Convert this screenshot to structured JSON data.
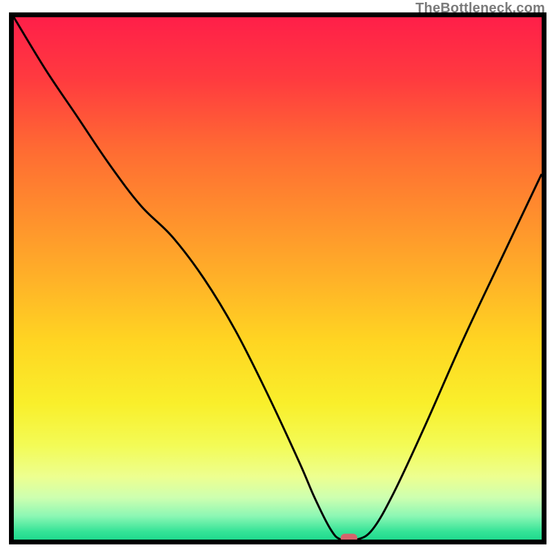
{
  "watermark": "TheBottleneck.com",
  "chart_data": {
    "type": "line",
    "title": "",
    "xlabel": "",
    "ylabel": "",
    "xlim": [
      0,
      100
    ],
    "ylim": [
      0,
      100
    ],
    "grid": false,
    "legend": false,
    "annotations": [],
    "background": {
      "type": "vertical_gradient",
      "stops": [
        {
          "offset": 0.0,
          "color": "#ff1f49"
        },
        {
          "offset": 0.12,
          "color": "#ff3b3f"
        },
        {
          "offset": 0.25,
          "color": "#ff6a33"
        },
        {
          "offset": 0.38,
          "color": "#ff8f2d"
        },
        {
          "offset": 0.5,
          "color": "#ffb128"
        },
        {
          "offset": 0.62,
          "color": "#ffd522"
        },
        {
          "offset": 0.74,
          "color": "#f9ef2b"
        },
        {
          "offset": 0.82,
          "color": "#f3fb56"
        },
        {
          "offset": 0.88,
          "color": "#edff90"
        },
        {
          "offset": 0.92,
          "color": "#cdffb0"
        },
        {
          "offset": 0.955,
          "color": "#8cf7b4"
        },
        {
          "offset": 0.985,
          "color": "#34e397"
        },
        {
          "offset": 1.0,
          "color": "#20da8e"
        }
      ]
    },
    "series": [
      {
        "name": "bottleneck-percentage-curve",
        "color": "#000000",
        "x": [
          0,
          6,
          12,
          18,
          24,
          30,
          36,
          42,
          48,
          54,
          57,
          60,
          62,
          65,
          68,
          72,
          78,
          85,
          92,
          100
        ],
        "y": [
          100,
          90,
          81,
          72,
          64,
          58,
          50,
          40,
          28,
          15,
          8,
          2,
          0,
          0,
          2,
          9,
          22,
          38,
          53,
          70
        ]
      }
    ],
    "marker": {
      "name": "optimum-point",
      "x": 63.5,
      "y": 0,
      "color": "#d4646c",
      "shape": "rounded-rect"
    },
    "frame": {
      "stroke": "#000000",
      "stroke_width": 7
    }
  }
}
